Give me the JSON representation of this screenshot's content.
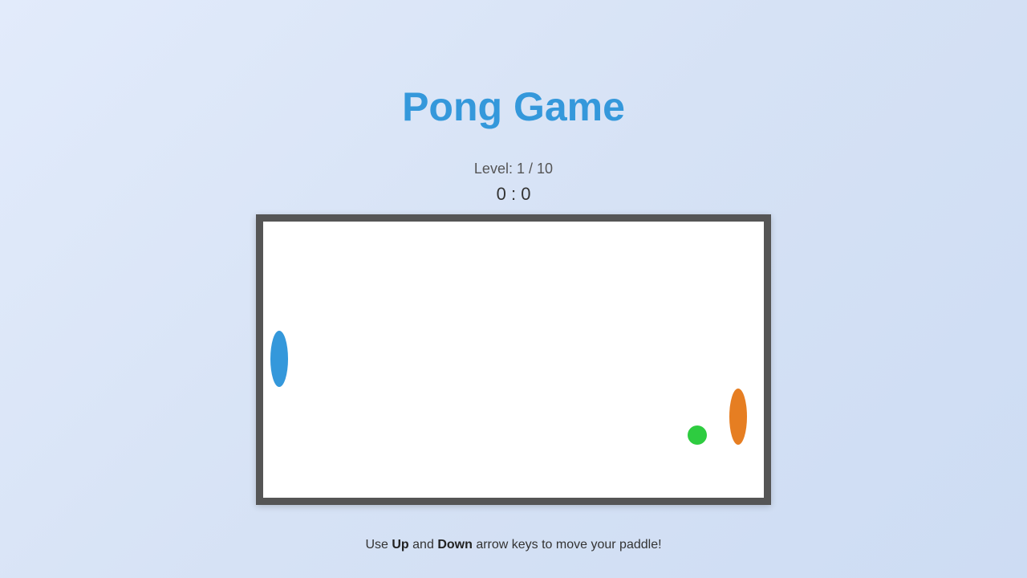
{
  "title": "Pong Game",
  "level": {
    "label": "Level:",
    "current": "1",
    "separator": "/",
    "max": "10"
  },
  "score": {
    "player": "0",
    "separator": ":",
    "opponent": "0"
  },
  "instructions": {
    "prefix": "Use",
    "key_up": "Up",
    "and": "and",
    "key_down": "Down",
    "suffix": "arrow keys to move your paddle!"
  },
  "colors": {
    "title": "#3498db",
    "player_paddle": "#3498db",
    "opponent_paddle": "#e67e22",
    "ball": "#2ecc40",
    "board_border": "#555555",
    "board_background": "#ffffff"
  }
}
